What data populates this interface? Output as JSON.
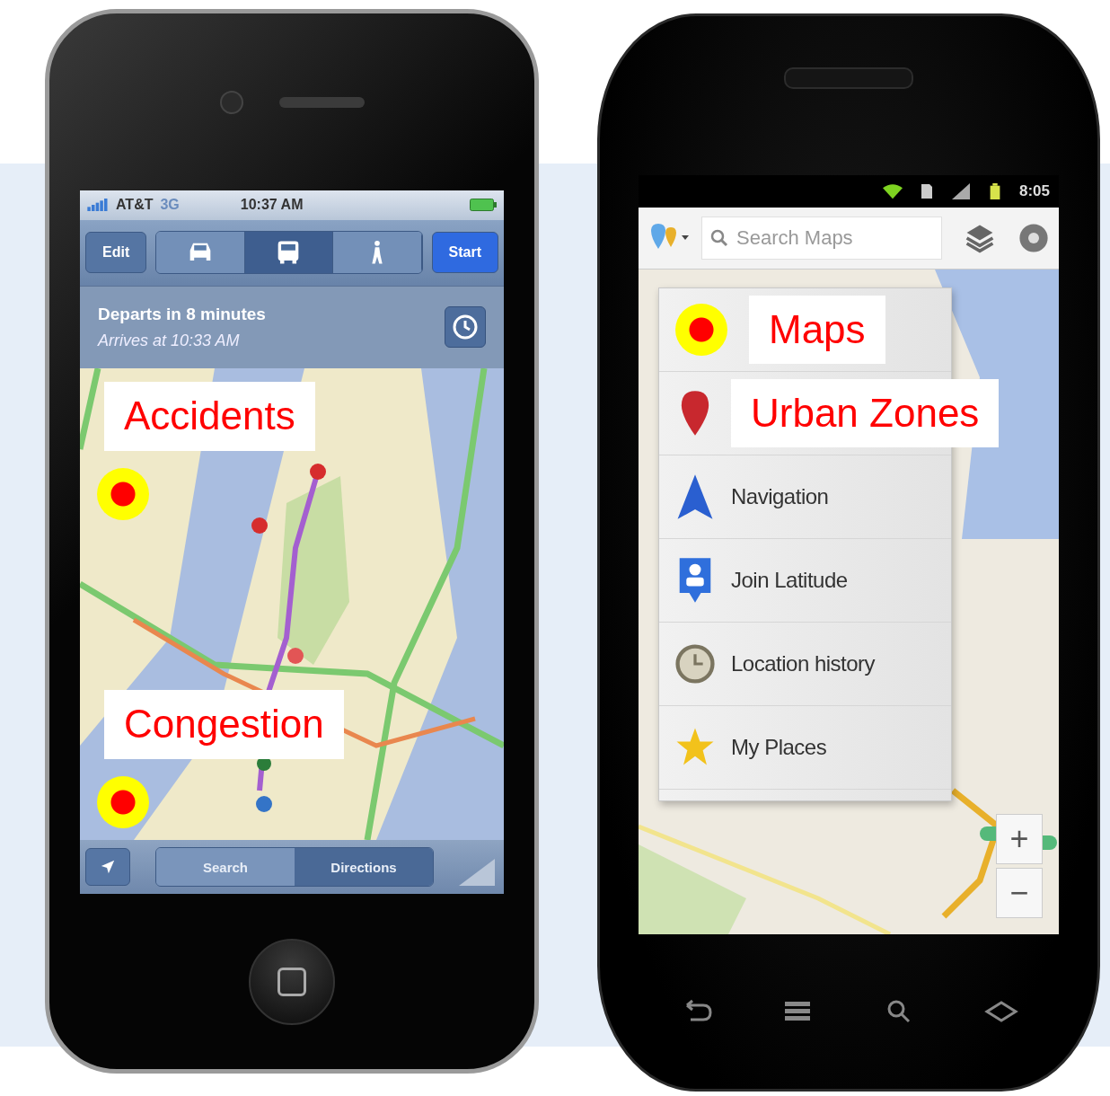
{
  "left_phone": {
    "status_bar": {
      "carrier": "AT&T",
      "network": "3G",
      "time": "10:37 AM"
    },
    "toolbar": {
      "edit": "Edit",
      "modes": [
        {
          "kind": "car",
          "selected": false
        },
        {
          "kind": "bus",
          "selected": true
        },
        {
          "kind": "walk",
          "selected": false
        }
      ],
      "start": "Start"
    },
    "trip": {
      "departs": "Departs in 8 minutes",
      "arrives": "Arrives at 10:33 AM"
    },
    "annotations": [
      {
        "label": "Accidents"
      },
      {
        "label": "Congestion"
      }
    ],
    "bottom_bar": {
      "tabs": [
        {
          "label": "Search",
          "selected": false
        },
        {
          "label": "Directions",
          "selected": true
        }
      ]
    }
  },
  "right_phone": {
    "status_bar": {
      "time": "8:05"
    },
    "search": {
      "placeholder": "Search Maps"
    },
    "menu": [
      {
        "kind": "annotation",
        "label": "Maps"
      },
      {
        "kind": "annotation",
        "label": "Urban Zones"
      },
      {
        "kind": "item",
        "label": "Navigation"
      },
      {
        "kind": "item",
        "label": "Join Latitude"
      },
      {
        "kind": "item",
        "label": "Location history"
      },
      {
        "kind": "item",
        "label": "My Places"
      }
    ],
    "zoom": {
      "in": "+",
      "out": "−"
    }
  }
}
